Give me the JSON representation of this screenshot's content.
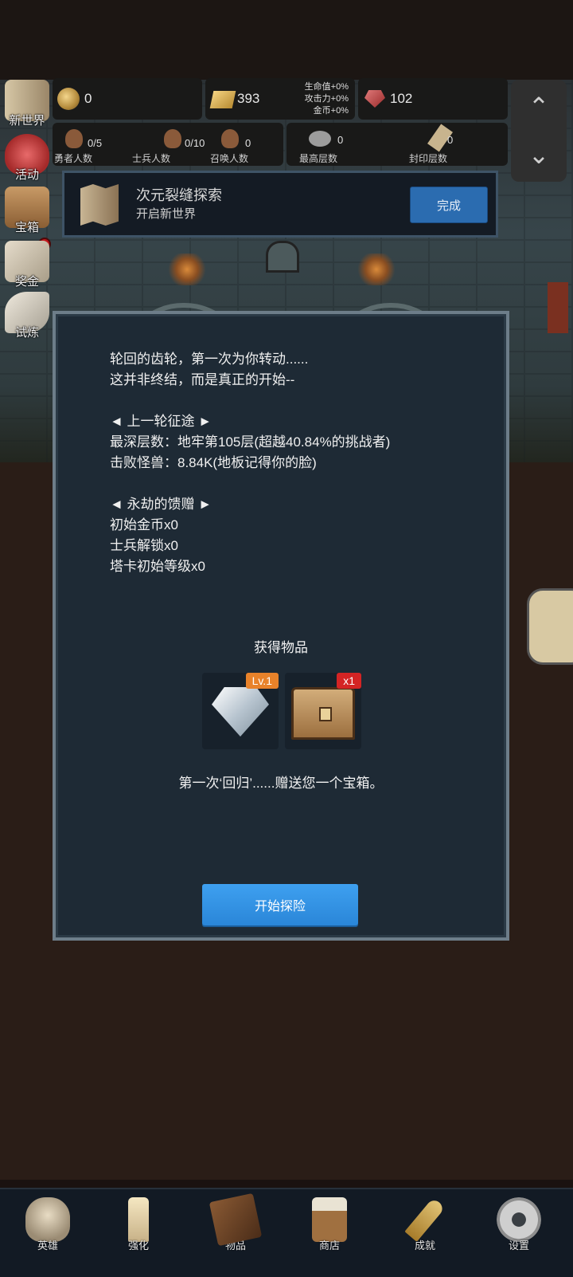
{
  "side_menu": [
    {
      "label": "新世界",
      "icon": "map-icon"
    },
    {
      "label": "活动",
      "icon": "heart-icon"
    },
    {
      "label": "宝箱",
      "icon": "chest-icon"
    },
    {
      "label": "奖金",
      "icon": "letter-icon"
    },
    {
      "label": "试炼",
      "icon": "feather-icon"
    }
  ],
  "resources": {
    "gold": "0",
    "gold_bar": "393",
    "buff_hp": "生命值+0%",
    "buff_atk": "攻击力+0%",
    "buff_gold": "金币+0%",
    "ruby": "102"
  },
  "counts": [
    {
      "value": "0/5",
      "label": "勇者人数"
    },
    {
      "value": "0/10",
      "label": "士兵人数"
    },
    {
      "value": "0",
      "label": "召唤人数"
    },
    {
      "value": "0",
      "label": "最高层数"
    },
    {
      "value": "0",
      "label": "封印层数"
    }
  ],
  "arrows": {
    "up": "⌃",
    "down": "⌄"
  },
  "quest": {
    "title": "次元裂缝探索",
    "subtitle": "开启新世界",
    "button": "完成"
  },
  "modal": {
    "intro_line1": "轮回的齿轮，第一次为你转动......",
    "intro_line2": "这并非终结，而是真正的开始--",
    "journey_header": "◄ 上一轮征途 ►",
    "deepest_floor": "最深层数：地牢第105层(超越40.84%的挑战者)",
    "monsters_killed": "击败怪兽：8.84K(地板记得你的脸)",
    "gift_header": "◄ 永劫的馈赠 ►",
    "gift_gold": "初始金币x0",
    "gift_soldier": "士兵解锁x0",
    "gift_tower": "塔卡初始等级x0",
    "obtain_title": "获得物品",
    "items": [
      {
        "tag": "Lv.1",
        "icon": "diamond-icon",
        "tag_color": "#e8822a"
      },
      {
        "tag": "x1",
        "icon": "treasure-chest-icon",
        "tag_color": "#d42424"
      }
    ],
    "description": "第一次‘回归’......赠送您一个宝箱。",
    "start_button": "开始探险"
  },
  "bottom_nav": [
    {
      "label": "英雄",
      "icon": "skull-icon"
    },
    {
      "label": "强化",
      "icon": "candle-icon"
    },
    {
      "label": "物品",
      "icon": "book-icon"
    },
    {
      "label": "商店",
      "icon": "mug-icon"
    },
    {
      "label": "成就",
      "icon": "key-icon"
    },
    {
      "label": "设置",
      "icon": "gear-icon"
    }
  ]
}
